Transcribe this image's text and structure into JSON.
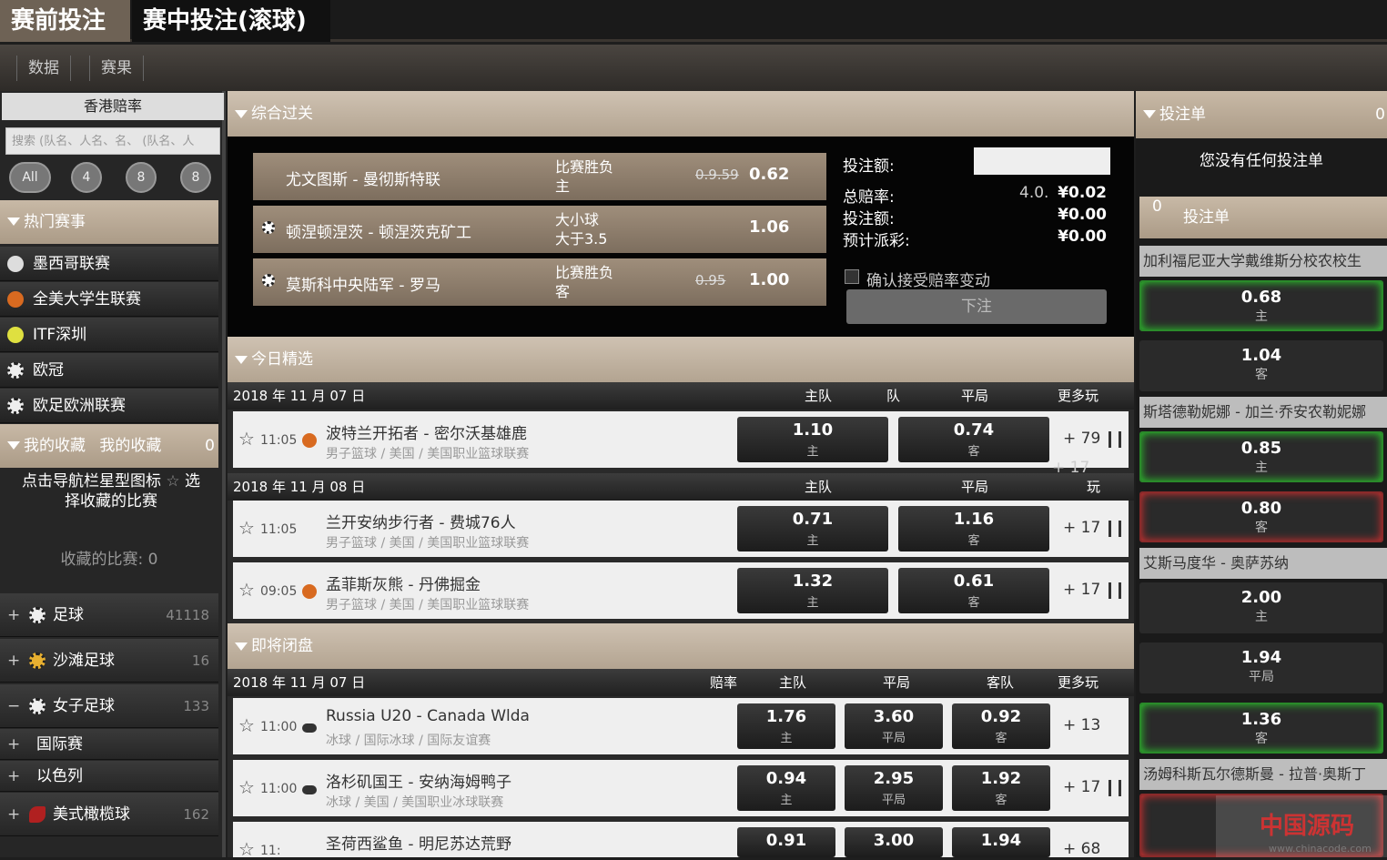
{
  "top": {
    "tab_pre": "赛前投注",
    "tab_live": "赛中投注(滚球)"
  },
  "sub": {
    "data": "数据",
    "results": "赛果"
  },
  "left": {
    "odds_tab": "香港赔率",
    "search_placeholder": "搜索 (队名、人名、名、 (队名、人",
    "filters": [
      "All",
      "4",
      "8",
      "8"
    ],
    "hot_title": "热门赛事",
    "hot_items": [
      "墨西哥联赛",
      "全美大学生联赛",
      "ITF深圳",
      "欧冠",
      "欧足欧洲联赛"
    ],
    "fav_title": "我的收藏",
    "fav_title2": "我的收藏",
    "fav_count": "0",
    "fav_tip": "点击导航栏星型图标",
    "fav_tip_star": "☆",
    "fav_tip_sel": "选",
    "fav_tip2": "择收藏的比赛",
    "fav_saved": "收藏的比赛: 0",
    "sports": [
      {
        "name": "足球",
        "count": "41118",
        "pm": "+"
      },
      {
        "name": "沙滩足球",
        "count": "16",
        "pm": "+"
      },
      {
        "name": "女子足球",
        "count": "133",
        "pm": "−"
      }
    ],
    "subs": [
      {
        "name": "国际赛",
        "pm": "+"
      },
      {
        "name": "以色列",
        "pm": "+"
      }
    ],
    "sport4": {
      "name": "美式橄榄球",
      "count": "162",
      "pm": "+"
    }
  },
  "combo": {
    "title": "综合过关",
    "rows": [
      {
        "teams": "尤文图斯 - 曼彻斯特联",
        "mkt1": "比赛胜负",
        "mkt2": "主",
        "old": "0.9.59",
        "odd": "0.62"
      },
      {
        "teams": "顿涅顿涅茨 - 顿涅茨克矿工",
        "mkt1": "大小球",
        "mkt2": "大于3.5",
        "old": "",
        "odd": "1.06"
      },
      {
        "teams": "莫斯科中央陆军 - 罗马",
        "mkt1": "比赛胜负",
        "mkt2": "客",
        "old": "0.95",
        "odd": "1.00"
      }
    ],
    "stake_label": "投注额:",
    "total_odds_label": "总赔率:",
    "total_odds_old": "4.0.",
    "total_odds_value": "¥0.02",
    "stake2_label": "投注额:",
    "stake2_value": "¥0.00",
    "payout_label": "预计派彩:",
    "payout_value": "¥0.00",
    "accept_label": "确认接受赔率变动",
    "place_bet": "下注"
  },
  "today": {
    "title": "今日精选",
    "col_home": "主队",
    "col_away": "队",
    "col_draw": "平局",
    "col_more": "更多玩",
    "col_more2": "玩",
    "date1": "2018 年 11 月 07 日",
    "date2": "2018 年 11 月 08 日",
    "matches": [
      {
        "time": "11:05",
        "teams": "波特兰开拓者 - 密尔沃基雄鹿",
        "league": "男子篮球 / 美国 / 美国职业篮球联赛",
        "o1": "1.10",
        "s1": "主",
        "o2": "0.74",
        "s2": "客",
        "more": "+ 79"
      },
      {
        "time": "11:05",
        "teams": "兰开安纳步行者 - 费城76人",
        "league": "男子篮球 / 美国 / 美国职业篮球联赛",
        "o1": "0.71",
        "s1": "主",
        "o2": "1.16",
        "s2": "客",
        "more": "+ 17"
      },
      {
        "time": "09:05",
        "teams": "孟菲斯灰熊 - 丹佛掘金",
        "league": "男子篮球 / 美国 / 美国职业篮球联赛",
        "o1": "1.32",
        "s1": "主",
        "o2": "0.61",
        "s2": "客",
        "more": "+ 17"
      }
    ],
    "more_float": "+ 17"
  },
  "closing": {
    "title": "即将闭盘",
    "date": "2018 年 11 月 07 日",
    "col_odds": "赔率",
    "col_home": "主队",
    "col_draw": "平局",
    "col_away": "客队",
    "col_more": "更多玩",
    "matches": [
      {
        "time": "11:00",
        "teams": "Russia U20 - Canada Wlda",
        "league": "冰球 / 国际冰球 / 国际友谊赛",
        "o1": "1.76",
        "s1": "主",
        "o2": "3.60",
        "s2": "平局",
        "o3": "0.92",
        "s3": "客",
        "more": "+ 13"
      },
      {
        "time": "11:00",
        "teams": "洛杉矶国王 - 安纳海姆鸭子",
        "league": "冰球 / 美国 / 美国职业冰球联赛",
        "o1": "0.94",
        "s1": "主",
        "o2": "2.95",
        "s2": "平局",
        "o3": "1.92",
        "s3": "客",
        "more": "+ 17"
      },
      {
        "time": "11:",
        "teams": "圣荷西鲨鱼 - 明尼苏达荒野",
        "league": "",
        "o1": "0.91",
        "s1": "",
        "o2": "3.00",
        "s2": "",
        "o3": "1.94",
        "s3": "",
        "more": "+ 68"
      }
    ]
  },
  "slip": {
    "title": "投注单",
    "count": "0",
    "empty": "您没有任何投注单",
    "sub_title": "投注单",
    "sub_count": "0",
    "items": [
      {
        "match": "加利福尼亚大学戴维斯分校农校生",
        "odds": [
          {
            "v": "0.68",
            "s": "主",
            "state": "up"
          },
          {
            "v": "1.04",
            "s": "客",
            "state": ""
          }
        ]
      },
      {
        "match": "斯塔德勒妮娜 - 加兰·乔安农勒妮娜",
        "odds": [
          {
            "v": "0.85",
            "s": "主",
            "state": "up"
          },
          {
            "v": "0.80",
            "s": "客",
            "state": "down"
          }
        ]
      },
      {
        "match": "艾斯马度华 - 奥萨苏纳",
        "odds": [
          {
            "v": "2.00",
            "s": "主",
            "state": ""
          },
          {
            "v": "1.94",
            "s": "平局",
            "state": ""
          },
          {
            "v": "1.36",
            "s": "客",
            "state": "up"
          }
        ]
      },
      {
        "match": "汤姆科斯瓦尔德斯曼 - 拉普·奥斯丁",
        "odds": []
      }
    ]
  },
  "logo": {
    "text": "中国源码",
    "url_text": "www.chinacode.com"
  },
  "colors": {
    "accent": "#b3a491",
    "up": "#2bd12b",
    "down": "#e03030"
  }
}
